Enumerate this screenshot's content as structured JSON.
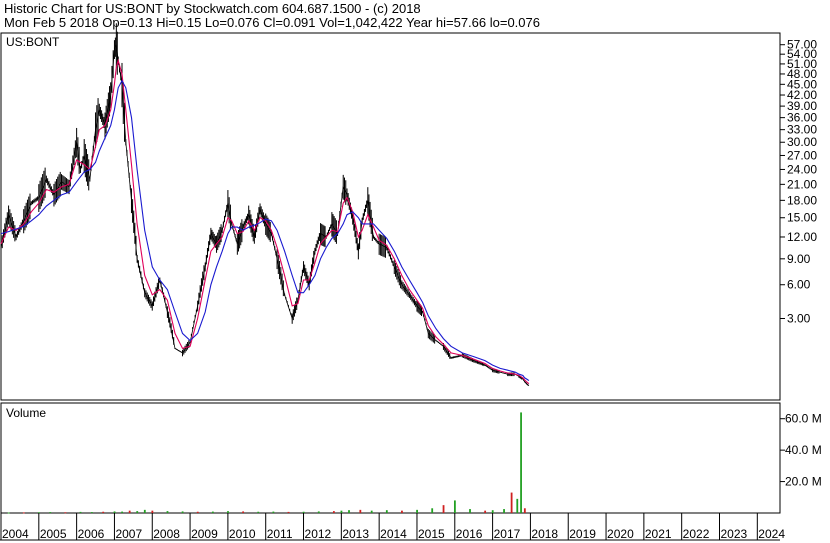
{
  "header": {
    "line1": "Historic Chart for US:BONT by Stockwatch.com 604.687.1500 - (c) 2018",
    "line2": "Mon Feb  5 2018  Op=0.13  Hi=0.15  Lo=0.076  Cl=0.091  Vol=1,042,422  Year hi=57.66  lo=0.076"
  },
  "colors": {
    "price": "#000000",
    "ma_short": "#e0005a",
    "ma_long": "#1a1ad0",
    "volume": "#22a022",
    "volume_down": "#d02020",
    "axis": "#000000"
  },
  "chart_data": [
    {
      "type": "line",
      "title": "US:BONT",
      "y_scale": "sqrt",
      "ylim": [
        0,
        59.5
      ],
      "y_ticks": [
        "3.00",
        "6.00",
        "9.00",
        "12.00",
        "15.00",
        "18.00",
        "21.00",
        "24.00",
        "27.00",
        "30.00",
        "33.00",
        "36.00",
        "39.00",
        "42.00",
        "45.00",
        "48.00",
        "51.00",
        "54.00",
        "57.00"
      ],
      "grid": false,
      "x": [
        2004.0,
        2004.2,
        2004.4,
        2004.6,
        2004.8,
        2005.0,
        2005.2,
        2005.4,
        2005.6,
        2005.8,
        2006.0,
        2006.1,
        2006.2,
        2006.35,
        2006.5,
        2006.6,
        2006.75,
        2006.9,
        2007.0,
        2007.05,
        2007.1,
        2007.2,
        2007.3,
        2007.45,
        2007.6,
        2007.8,
        2008.0,
        2008.2,
        2008.4,
        2008.6,
        2008.8,
        2009.0,
        2009.2,
        2009.4,
        2009.55,
        2009.7,
        2009.85,
        2010.0,
        2010.1,
        2010.25,
        2010.4,
        2010.55,
        2010.7,
        2010.85,
        2011.0,
        2011.15,
        2011.3,
        2011.5,
        2011.7,
        2011.85,
        2012.0,
        2012.15,
        2012.3,
        2012.45,
        2012.6,
        2012.75,
        2012.9,
        2013.05,
        2013.15,
        2013.3,
        2013.45,
        2013.55,
        2013.7,
        2013.85,
        2014.0,
        2014.2,
        2014.4,
        2014.6,
        2014.8,
        2015.0,
        2015.15,
        2015.3,
        2015.5,
        2015.7,
        2015.9,
        2016.2,
        2016.5,
        2016.8,
        2017.0,
        2017.2,
        2017.4,
        2017.6,
        2017.7,
        2017.8,
        2017.85,
        2017.9,
        2017.96
      ],
      "series": [
        {
          "values": [
            10.5,
            15.5,
            12.0,
            14.5,
            17.5,
            18.5,
            22.0,
            19.0,
            21.5,
            20.5,
            30.0,
            24.0,
            27.0,
            22.0,
            33.0,
            38.0,
            34.0,
            42.0,
            55.5,
            57.0,
            52.0,
            45.0,
            30.0,
            18.0,
            9.0,
            5.2,
            4.0,
            6.5,
            3.5,
            1.2,
            1.0,
            1.5,
            4.0,
            8.0,
            12.5,
            11.0,
            13.0,
            17.5,
            14.0,
            11.0,
            13.5,
            15.5,
            12.0,
            16.5,
            14.0,
            12.5,
            9.0,
            5.0,
            3.0,
            4.5,
            8.0,
            6.0,
            10.0,
            12.5,
            12.0,
            14.0,
            12.5,
            20.5,
            19.0,
            15.0,
            10.0,
            14.5,
            18.0,
            12.0,
            11.0,
            10.5,
            8.0,
            6.0,
            5.0,
            4.0,
            3.5,
            2.0,
            1.6,
            1.3,
            0.8,
            0.9,
            0.7,
            0.55,
            0.4,
            0.35,
            0.3,
            0.3,
            0.25,
            0.2,
            0.15,
            0.12,
            0.091
          ]
        },
        {
          "values": [
            11.0,
            13.5,
            13.0,
            14.0,
            16.0,
            17.5,
            20.0,
            19.5,
            20.5,
            21.0,
            26.0,
            25.5,
            25.0,
            24.0,
            29.0,
            33.0,
            34.0,
            38.0,
            45.0,
            50.0,
            52.0,
            48.0,
            38.0,
            25.0,
            14.0,
            7.0,
            5.0,
            5.5,
            4.5,
            2.0,
            1.2,
            1.3,
            3.0,
            6.5,
            10.0,
            11.0,
            12.0,
            15.0,
            14.5,
            12.5,
            12.8,
            14.5,
            13.0,
            15.0,
            14.5,
            13.0,
            10.5,
            7.0,
            4.0,
            4.2,
            6.5,
            6.5,
            8.5,
            11.0,
            12.0,
            13.0,
            12.8,
            17.5,
            18.5,
            16.0,
            12.0,
            13.0,
            15.5,
            13.5,
            11.5,
            10.8,
            9.0,
            7.0,
            5.5,
            4.5,
            3.8,
            2.5,
            1.8,
            1.4,
            1.0,
            0.9,
            0.75,
            0.6,
            0.45,
            0.38,
            0.33,
            0.3,
            0.27,
            0.22,
            0.18,
            0.15,
            0.12
          ]
        },
        {
          "values": [
            12.5,
            12.8,
            13.2,
            13.6,
            14.5,
            15.5,
            17.0,
            18.0,
            19.0,
            19.5,
            21.5,
            22.5,
            23.5,
            24.0,
            25.5,
            28.0,
            31.0,
            34.0,
            38.0,
            41.0,
            44.0,
            46.0,
            44.0,
            36.0,
            24.0,
            13.0,
            8.0,
            6.5,
            5.5,
            3.5,
            2.0,
            1.6,
            2.0,
            3.5,
            6.0,
            8.0,
            10.0,
            12.5,
            13.5,
            13.5,
            13.0,
            13.5,
            13.8,
            14.2,
            14.8,
            14.5,
            13.0,
            10.0,
            7.0,
            5.2,
            5.2,
            6.0,
            7.0,
            9.0,
            10.5,
            11.8,
            12.5,
            14.0,
            15.5,
            16.0,
            15.0,
            14.0,
            14.0,
            14.0,
            13.0,
            11.8,
            10.0,
            8.0,
            6.5,
            5.2,
            4.3,
            3.2,
            2.3,
            1.7,
            1.3,
            1.0,
            0.85,
            0.7,
            0.55,
            0.45,
            0.4,
            0.35,
            0.3,
            0.27,
            0.22,
            0.2,
            0.17
          ]
        }
      ]
    },
    {
      "type": "bar",
      "title": "Volume",
      "ylim": [
        0,
        70000000
      ],
      "y_ticks": [
        "20.0 M",
        "40.0 M",
        "60.0 M"
      ],
      "x": [
        2004.2,
        2004.6,
        2005.0,
        2005.3,
        2005.7,
        2006.1,
        2006.4,
        2006.7,
        2007.0,
        2007.2,
        2007.4,
        2007.6,
        2007.8,
        2008.0,
        2008.4,
        2008.8,
        2009.2,
        2009.6,
        2010.0,
        2010.4,
        2010.8,
        2011.2,
        2011.6,
        2012.0,
        2012.4,
        2012.8,
        2013.0,
        2013.2,
        2013.5,
        2013.8,
        2014.2,
        2014.6,
        2015.0,
        2015.4,
        2015.7,
        2016.0,
        2016.4,
        2016.8,
        2017.0,
        2017.3,
        2017.5,
        2017.65,
        2017.75,
        2017.85
      ],
      "values": [
        300000,
        400000,
        500000,
        600000,
        500000,
        700000,
        600000,
        800000,
        1000000,
        900000,
        1500000,
        1200000,
        2000000,
        1500000,
        1200000,
        1000000,
        800000,
        900000,
        1200000,
        1000000,
        800000,
        900000,
        700000,
        800000,
        1000000,
        1200000,
        1500000,
        1800000,
        2000000,
        1500000,
        1800000,
        1500000,
        2000000,
        3000000,
        5000000,
        8000000,
        2500000,
        1500000,
        1800000,
        2500000,
        13000000,
        9000000,
        64000000,
        3000000
      ]
    }
  ],
  "x_axis": {
    "year_labels": [
      "2004",
      "2005",
      "2006",
      "2007",
      "2008",
      "2009",
      "2010",
      "2011",
      "2012",
      "2013",
      "2014",
      "2015",
      "2016",
      "2017",
      "2018",
      "2019",
      "2020",
      "2021",
      "2022",
      "2023",
      "2024"
    ]
  }
}
